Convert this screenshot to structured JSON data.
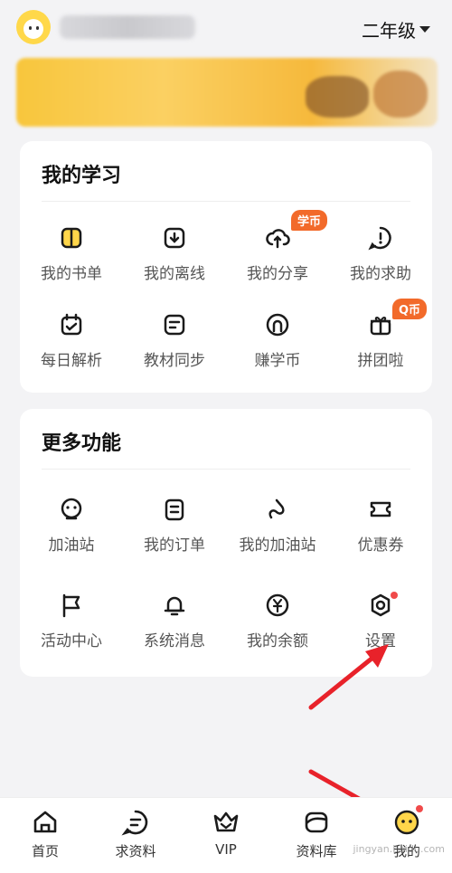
{
  "header": {
    "grade": "二年级"
  },
  "learning": {
    "title": "我的学习",
    "items": [
      {
        "label": "我的书单"
      },
      {
        "label": "我的离线"
      },
      {
        "label": "我的分享",
        "badge": "学币"
      },
      {
        "label": "我的求助"
      },
      {
        "label": "每日解析"
      },
      {
        "label": "教材同步"
      },
      {
        "label": "赚学币"
      },
      {
        "label": "拼团啦",
        "badge": "Q币"
      }
    ]
  },
  "more": {
    "title": "更多功能",
    "items": [
      {
        "label": "加油站"
      },
      {
        "label": "我的订单"
      },
      {
        "label": "我的加油站"
      },
      {
        "label": "优惠券"
      },
      {
        "label": "活动中心"
      },
      {
        "label": "系统消息"
      },
      {
        "label": "我的余额"
      },
      {
        "label": "设置"
      }
    ]
  },
  "tabbar": {
    "items": [
      {
        "label": "首页"
      },
      {
        "label": "求资料"
      },
      {
        "label": "VIP"
      },
      {
        "label": "资料库"
      },
      {
        "label": "我的"
      }
    ]
  },
  "watermark": "jingyan.baidu.com",
  "colors": {
    "accent": "#f26a2a",
    "arrow": "#e8222a",
    "icon": "#1b1b1b",
    "icon_fill": "#ffd64a"
  }
}
